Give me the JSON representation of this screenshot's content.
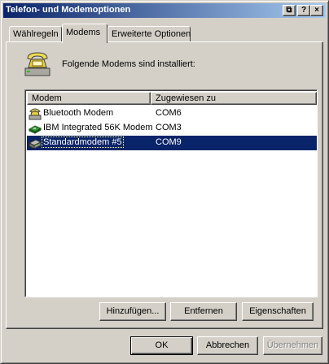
{
  "window": {
    "title": "Telefon- und Modemoptionen",
    "title_buttons": {
      "properties": "⧉",
      "help": "?",
      "close": "×"
    },
    "accent": "#0a246a"
  },
  "tabs": [
    {
      "label": "Wählregeln",
      "active": false
    },
    {
      "label": "Modems",
      "active": true
    },
    {
      "label": "Erweiterte Optionen",
      "active": false
    }
  ],
  "panel": {
    "icon": "telephone-modem-icon",
    "intro": "Folgende Modems sind installiert:",
    "columns": {
      "modem": "Modem",
      "port": "Zugewiesen zu"
    },
    "rows": [
      {
        "icon": "bluetooth-modem-icon",
        "name": "Bluetooth Modem",
        "port": "COM6",
        "selected": false
      },
      {
        "icon": "modem-card-icon",
        "name": "IBM Integrated 56K Modem",
        "port": "COM3",
        "selected": false
      },
      {
        "icon": "external-modem-icon",
        "name": "Standardmodem #5",
        "port": "COM9",
        "selected": true
      }
    ],
    "buttons": {
      "add": "Hinzufügen...",
      "remove": "Entfernen",
      "properties": "Eigenschaften"
    }
  },
  "dialog_buttons": {
    "ok": "OK",
    "cancel": "Abbrechen",
    "apply": "Übernehmen"
  }
}
